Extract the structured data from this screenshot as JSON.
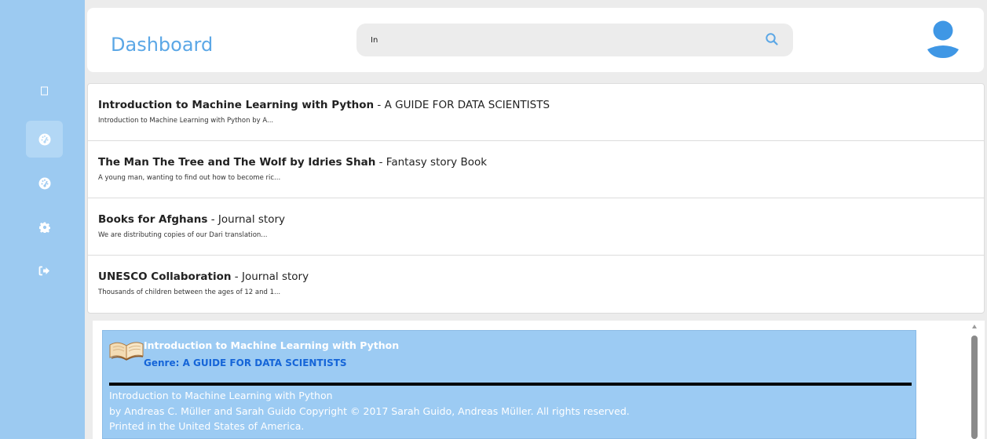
{
  "header": {
    "title": "Dashboard",
    "search": {
      "value": "In",
      "placeholder": ""
    }
  },
  "sidebar": {
    "items": [
      {
        "icon": "square-icon",
        "active": false
      },
      {
        "icon": "dashboard-gauge-icon",
        "active": true
      },
      {
        "icon": "dashboard-gauge-icon",
        "active": false
      },
      {
        "icon": "gear-icon",
        "active": false
      },
      {
        "icon": "sign-out-icon",
        "active": false
      }
    ]
  },
  "results": [
    {
      "title": "Introduction to Machine Learning with Python",
      "separator": " - ",
      "genre": "A GUIDE FOR DATA SCIENTISTS",
      "snippet": "Introduction to Machine Learning with Python by A..."
    },
    {
      "title": "The Man The Tree and The Wolf by Idries Shah",
      "separator": " - ",
      "genre": "Fantasy story Book",
      "snippet": "A young man, wanting to find out how to become ric..."
    },
    {
      "title": "Books for Afghans",
      "separator": " - ",
      "genre": "Journal story",
      "snippet": "We are distributing copies of our Dari translation..."
    },
    {
      "title": "UNESCO Collaboration",
      "separator": " - ",
      "genre": "Journal story",
      "snippet": "Thousands of children between the ages of 12 and 1..."
    }
  ],
  "detail": {
    "title": "Introduction to Machine Learning with Python",
    "genre_line": "Genre: A GUIDE FOR DATA SCIENTISTS",
    "lines": [
      "Introduction to Machine Learning with Python",
      "by Andreas C. Müller and Sarah Guido Copyright © 2017 Sarah Guido, Andreas Müller. All rights reserved.",
      "Printed in the United States of America."
    ]
  },
  "colors": {
    "sidebar": "#9ccaf1",
    "accent": "#5ba7e6",
    "card": "#9ccbf3",
    "genre": "#1565d8"
  }
}
